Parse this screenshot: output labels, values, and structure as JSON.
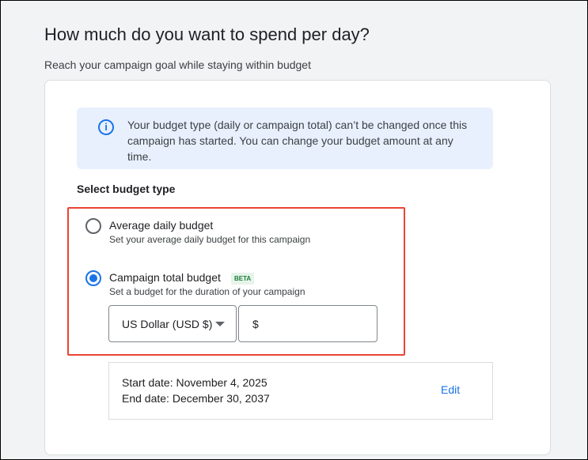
{
  "header": {
    "title": "How much do you want to spend per day?",
    "subtitle": "Reach your campaign goal while staying within budget"
  },
  "info": {
    "icon": "info-icon",
    "glyph": "i",
    "text": "Your budget type (daily or campaign total) can’t be changed once this campaign has started. You can change your budget amount at any time."
  },
  "budget_type": {
    "label": "Select budget type",
    "options": [
      {
        "label": "Average daily budget",
        "description": "Set your average daily budget for this campaign",
        "selected": false
      },
      {
        "label": "Campaign total budget",
        "badge": "BETA",
        "description": "Set a budget for the duration of your campaign",
        "selected": true
      }
    ],
    "currency": "US Dollar (USD $)",
    "amount_prefix": "$",
    "amount_value": ""
  },
  "dates": {
    "start": "Start date: November 4, 2025",
    "end": "End date: December 30, 2037",
    "edit_label": "Edit"
  },
  "colors": {
    "accent": "#1a73e8",
    "highlight": "#ea4335",
    "background": "#f1f3f4"
  }
}
